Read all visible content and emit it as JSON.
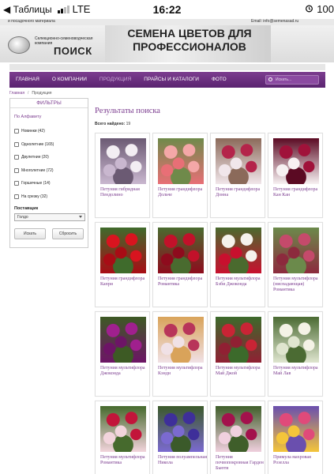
{
  "status_bar": {
    "back_label": "◀ Таблицы",
    "carrier": "LTE",
    "time": "16:22",
    "battery": "100"
  },
  "header": {
    "seed_text": "и посадочного материала",
    "company_small": "Селекционно-семеноводческая компания",
    "company_name": "ПОИСК",
    "slogan": "Семена цветов для профессионалов",
    "email": "Email: info@semenasad.ru"
  },
  "nav": {
    "items": [
      {
        "label": "Главная",
        "active": false
      },
      {
        "label": "О компании",
        "active": false
      },
      {
        "label": "Продукция",
        "active": true
      },
      {
        "label": "Прайсы и каталоги",
        "active": false
      },
      {
        "label": "Фото",
        "active": false
      }
    ],
    "search_placeholder": "Искать..."
  },
  "breadcrumb": {
    "home": "Главная",
    "current": "Продукция"
  },
  "filters": {
    "title": "Фильтры",
    "alpha_label": "По Алфавиту",
    "options": [
      {
        "label": "Новинки (42)"
      },
      {
        "label": "Однолетние (165)"
      },
      {
        "label": "Двулетние (20)"
      },
      {
        "label": "Многолетние (72)"
      },
      {
        "label": "Горшечные (14)"
      },
      {
        "label": "На срезку (32)"
      }
    ],
    "supplier_label": "Поставщик",
    "supplier_value": "Голдо",
    "find_button": "Искать",
    "reset_button": "Сбросить"
  },
  "results": {
    "title": "Результаты поиска",
    "count_label": "Всего найдено:",
    "count": "19"
  },
  "products": [
    {
      "name": "Петуния гибридная Пендолино",
      "colors": [
        "#f3eef3",
        "#c9b7cf",
        "#6b5a73"
      ]
    },
    {
      "name": "Петуния грандифлора Дольче",
      "colors": [
        "#f4a7a7",
        "#e86f76",
        "#6f8a4a"
      ]
    },
    {
      "name": "Петуния грандифлора Донна",
      "colors": [
        "#b4244a",
        "#f1e6ea",
        "#8b6a5a"
      ]
    },
    {
      "name": "Петуния грандифлора Кан Кан",
      "colors": [
        "#a0123a",
        "#f7f1f2",
        "#5b0a23"
      ]
    },
    {
      "name": "Петуния грандифлора Капри",
      "colors": [
        "#d8141f",
        "#a80c15",
        "#3f6b2c"
      ]
    },
    {
      "name": "Петуния грандифлора Романтика",
      "colors": [
        "#c2112a",
        "#8e0b1d",
        "#496b2f"
      ]
    },
    {
      "name": "Петуния мультифлора Бэби Джоконда",
      "colors": [
        "#f5f2ec",
        "#c8102e",
        "#4a6a2e"
      ]
    },
    {
      "name": "Петуния мультифлора (ниспадающая) Романтика",
      "colors": [
        "#c54a6b",
        "#8c2a3d",
        "#6b8a4b"
      ]
    },
    {
      "name": "Петуния мультифлора Джоконда",
      "colors": [
        "#a0208e",
        "#6d1466",
        "#3d5a24"
      ]
    },
    {
      "name": "Петуния мультифлора Кэнди",
      "colors": [
        "#b8355a",
        "#f0e1e6",
        "#d9a35a"
      ]
    },
    {
      "name": "Петуния мультифлора Май Джой",
      "colors": [
        "#c92435",
        "#902033",
        "#3c6a2b"
      ]
    },
    {
      "name": "Петуния мультифлора Май Лав",
      "colors": [
        "#f4f2e6",
        "#dfe5cf",
        "#4b6b33"
      ]
    },
    {
      "name": "Петуния мультифлора Романтика",
      "colors": [
        "#c2153a",
        "#f2d4dc",
        "#466a2d"
      ]
    },
    {
      "name": "Петуния полуампельная Никола",
      "colors": [
        "#3e2f9a",
        "#7b6ad0",
        "#3b5a2a"
      ]
    },
    {
      "name": "Петуния почвопокровная Гарден Бьюти",
      "colors": [
        "#a3124c",
        "#f0d0de",
        "#3f5e2a"
      ]
    },
    {
      "name": "Примула махровая Розелла",
      "colors": [
        "#e04a7a",
        "#f4c53a",
        "#6a4fae"
      ]
    }
  ]
}
